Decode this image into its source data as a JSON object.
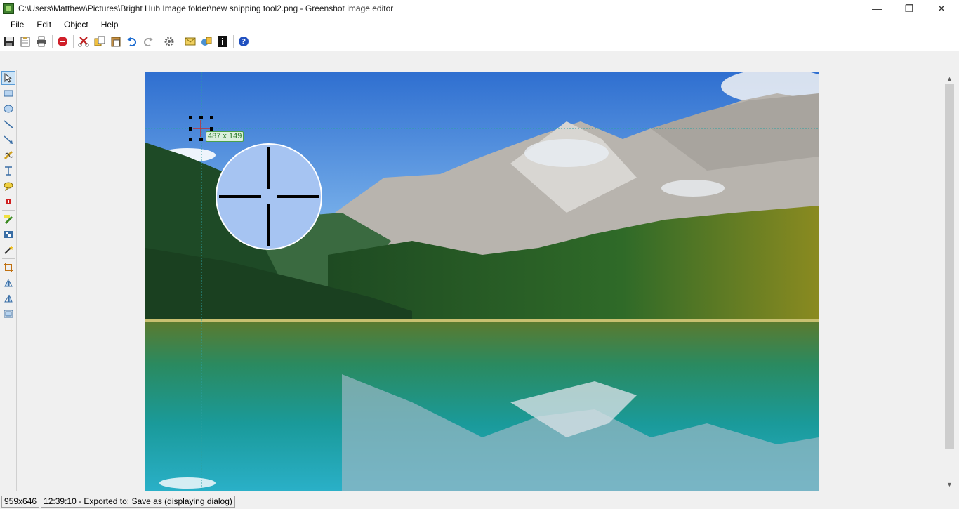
{
  "window": {
    "title": "C:\\Users\\Matthew\\Pictures\\Bright Hub Image folder\\new snipping tool2.png - Greenshot image editor",
    "minimize_glyph": "—",
    "restore_glyph": "❐",
    "close_glyph": "✕"
  },
  "menu": {
    "items": [
      "File",
      "Edit",
      "Object",
      "Help"
    ]
  },
  "toolbar": {
    "icons": [
      "save-icon",
      "clipboard-icon",
      "print-icon",
      "close-red-icon",
      "cut-icon",
      "copy-icon",
      "paste-icon",
      "undo-icon",
      "redo-icon",
      "settings-icon",
      "email-icon",
      "upload-icon",
      "info-icon",
      "help-icon"
    ]
  },
  "left_tools": {
    "icons": [
      "select-icon",
      "rectangle-icon",
      "ellipse-icon",
      "line-icon",
      "arrow-icon",
      "freehand-icon",
      "text-icon",
      "speechbubble-icon",
      "counter-icon",
      "highlight-icon",
      "obfuscate-icon",
      "effects-icon",
      "crop-icon",
      "rotate-cw-icon",
      "rotate-ccw-icon",
      "resize-icon"
    ]
  },
  "canvas": {
    "selection_size_label": "487 x 149"
  },
  "scrollbar": {
    "up_glyph": "▲",
    "down_glyph": "▼"
  },
  "status": {
    "dimensions": "959x646",
    "message": "12:39:10 - Exported to: Save as (displaying dialog)"
  },
  "colors": {
    "accent_blue": "#5a9bd5",
    "sky_top": "#3a78d4",
    "lake": "#1a8a8a",
    "guide_line": "#2aa0a0"
  }
}
